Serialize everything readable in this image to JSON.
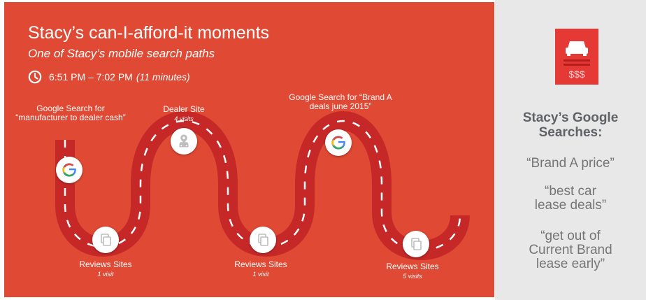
{
  "header": {
    "title": "Stacy’s can-I-afford-it moments",
    "subtitle": "One of Stacy’s mobile search paths",
    "time_range": "6:51 PM – 7:02 PM",
    "duration": "(11 minutes)"
  },
  "path": {
    "stops": [
      {
        "label": "Google Search for “manufacturer to dealer cash”",
        "detail": "",
        "icon": "google-icon"
      },
      {
        "label": "Reviews Sites",
        "detail": "1 visit",
        "icon": "document-icon"
      },
      {
        "label": "Dealer Site",
        "detail": "4 visits",
        "icon": "car-pin-icon"
      },
      {
        "label": "Reviews Sites",
        "detail": "1 visit",
        "icon": "document-icon"
      },
      {
        "label": "Google Search for “Brand A deals june 2015”",
        "detail": "",
        "icon": "google-icon"
      },
      {
        "label": "Reviews Sites",
        "detail": "5 visits",
        "icon": "document-icon"
      }
    ]
  },
  "sidebar": {
    "icon": "car-price-card-icon",
    "card_text": "$$$",
    "heading": "Stacy’s Google Searches:",
    "queries": [
      "“Brand A price”",
      "“best car lease deals”",
      "“get out of Current Brand lease early”"
    ]
  },
  "colors": {
    "background_main": "#e04933",
    "road": "#c62828",
    "sidebar_bg": "#e8e8e8",
    "card": "#e53935",
    "google_blue": "#4285f4",
    "google_red": "#ea4335",
    "google_yellow": "#fbbc05",
    "google_green": "#34a853"
  }
}
